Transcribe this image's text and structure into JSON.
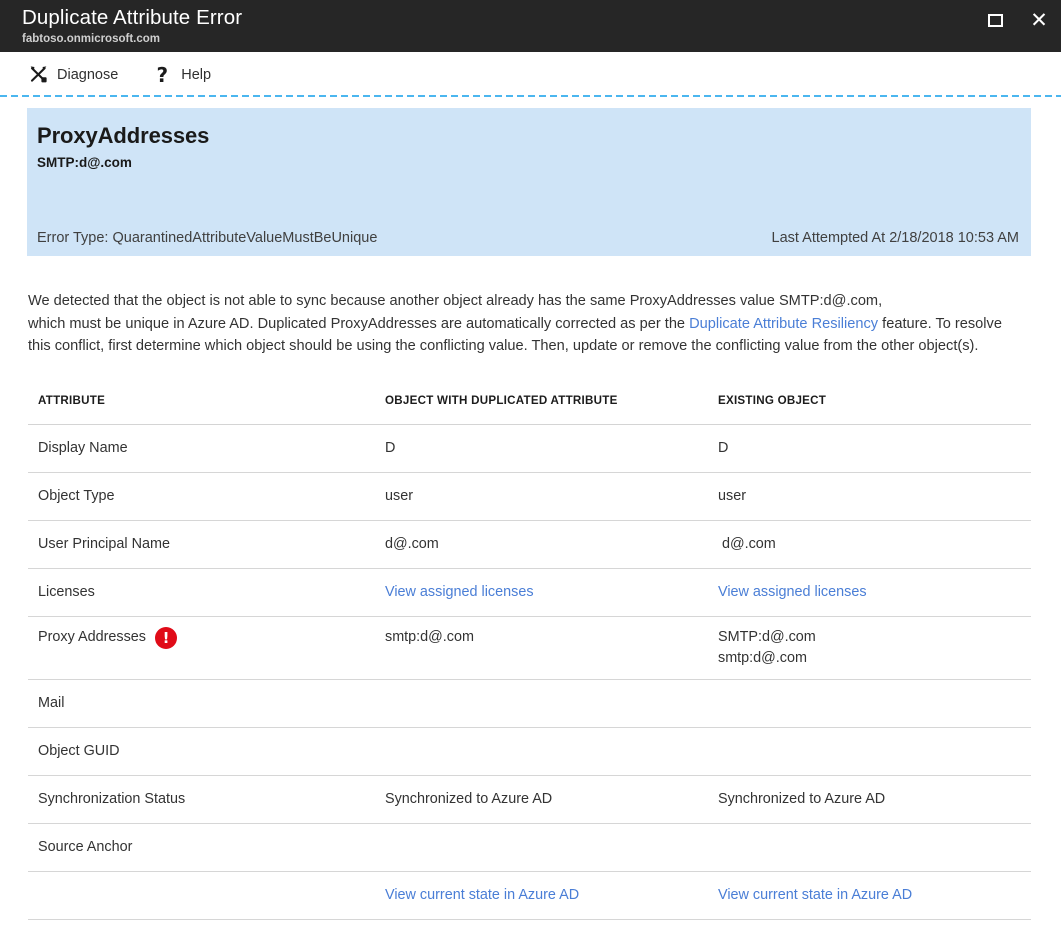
{
  "titlebar": {
    "title": "Duplicate Attribute Error",
    "subtitle": "fabtoso.onmicrosoft.com",
    "restore_icon": "restore-window-icon",
    "close_icon": "close-icon",
    "close_glyph": "✕"
  },
  "toolbar": {
    "items": [
      {
        "label": "Diagnose",
        "icon": "diagnose-tools-icon"
      },
      {
        "label": "Help",
        "icon": "question-mark-icon",
        "glyph": "?"
      }
    ]
  },
  "banner": {
    "title": "ProxyAddresses",
    "subtitle": "SMTP:d@.com",
    "error_type": "Error Type: QuarantinedAttributeValueMustBeUnique",
    "last_attempted": "Last Attempted At 2/18/2018 10:53 AM",
    "background_color": "#cfe4f7"
  },
  "description": {
    "part1": "We detected that the object is not able to sync because another object already has the same ProxyAddresses value SMTP:d@.com,",
    "part2": "which must be unique in Azure AD. Duplicated ProxyAddresses are automatically corrected as per the ",
    "link": "Duplicate Attribute Resiliency",
    "part3": " feature. To resolve this conflict, first determine which object should be using the conflicting value. Then, update or remove the conflicting value from the other object(s).",
    "link_color": "#4a7ed6"
  },
  "table": {
    "headers": [
      "ATTRIBUTE",
      "OBJECT WITH DUPLICATED ATTRIBUTE",
      "EXISTING OBJECT"
    ],
    "rows": [
      {
        "attribute": "Display Name",
        "duplicated": "D",
        "existing": "D"
      },
      {
        "attribute": "Object Type",
        "duplicated": "user",
        "existing": "user"
      },
      {
        "attribute": "User Principal Name",
        "duplicated": "d@.com",
        "existing": "d@.com"
      },
      {
        "attribute": "Licenses",
        "duplicated": "View assigned licenses",
        "existing": "View assigned licenses"
      },
      {
        "attribute": "Proxy Addresses",
        "duplicated": "smtp:d@.com",
        "existing_line1": "SMTP:d@.com",
        "existing_line2": "smtp:d@.com"
      },
      {
        "attribute": "Mail",
        "duplicated": "",
        "existing": ""
      },
      {
        "attribute": "Object GUID",
        "duplicated": "",
        "existing": ""
      },
      {
        "attribute": "Synchronization Status",
        "duplicated": "Synchronized to Azure AD",
        "existing": "Synchronized to Azure AD"
      },
      {
        "attribute": "Source Anchor",
        "duplicated": "",
        "existing": ""
      },
      {
        "attribute": "",
        "duplicated": "View current state in Azure AD",
        "existing": "View current state in Azure AD"
      }
    ],
    "error_badge": {
      "icon": "error-exclamation-icon",
      "glyph": "!",
      "color": "#e00b18"
    }
  }
}
